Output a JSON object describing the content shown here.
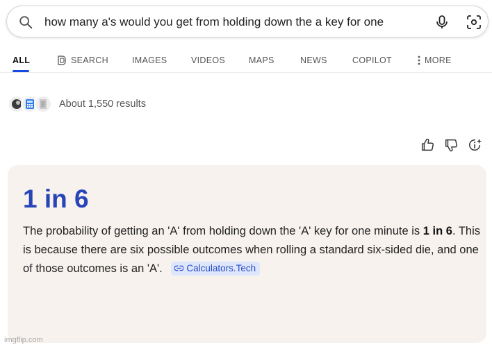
{
  "search": {
    "query": "how many a's would you get from holding down the a key for one"
  },
  "tabs": [
    {
      "label": "ALL",
      "icon": ""
    },
    {
      "label": "SEARCH",
      "icon": "copilot-search-icon"
    },
    {
      "label": "IMAGES",
      "icon": ""
    },
    {
      "label": "VIDEOS",
      "icon": ""
    },
    {
      "label": "MAPS",
      "icon": ""
    },
    {
      "label": "NEWS",
      "icon": ""
    },
    {
      "label": "COPILOT",
      "icon": ""
    },
    {
      "label": "MORE",
      "icon": "kebab-icon"
    }
  ],
  "results": {
    "count_text": "About 1,550 results",
    "favicons": [
      "dark-circle-icon",
      "calculator-icon",
      "document-icon"
    ]
  },
  "feedback": {
    "icons": [
      "thumbs-up-icon",
      "thumbs-down-icon",
      "info-sparkle-icon"
    ]
  },
  "answer": {
    "title": "1 in 6",
    "body_1": "The probability of getting an 'A' from holding down the 'A' key for one minute is ",
    "body_bold_1": "1 in 6",
    "body_2": ". This is because there are six possible outcomes when rolling a standard six-sided die, and one of those outcomes is an 'A'.",
    "source_label": "Calculators.Tech"
  },
  "watermark": "imgflip.com",
  "colors": {
    "accent": "#174ae4",
    "answer_title": "#2845b8",
    "card_bg": "#f7f2ee",
    "chip_bg": "#dde6fb"
  }
}
